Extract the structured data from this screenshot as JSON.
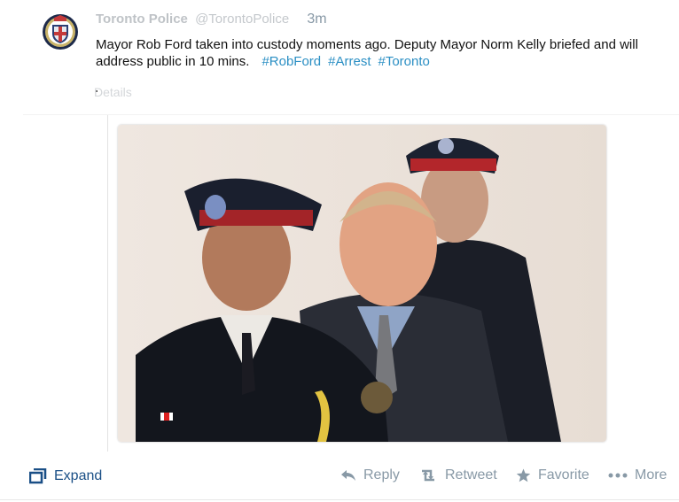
{
  "tweet": {
    "author_name": "Toronto Police",
    "handle": "@TorontoPolice",
    "time": "3m",
    "text": "Mayor Rob Ford taken into custody moments ago. Deputy Mayor Norm Kelly briefed and will address public in 10 mins.",
    "hashtags": [
      "#RobFord",
      "#Arrest",
      "#Toronto"
    ],
    "details_label": "Details"
  },
  "actions": {
    "expand_label": "Expand",
    "reply_label": "Reply",
    "retweet_label": "Retweet",
    "favorite_label": "Favorite",
    "more_label": "More"
  },
  "colors": {
    "link": "#2b8fc4",
    "expand": "#1a4f86",
    "muted": "#8899a6"
  },
  "icons": [
    "toronto-police-crest-icon",
    "expand-icon",
    "reply-icon",
    "retweet-icon",
    "star-icon",
    "ellipsis-icon"
  ]
}
